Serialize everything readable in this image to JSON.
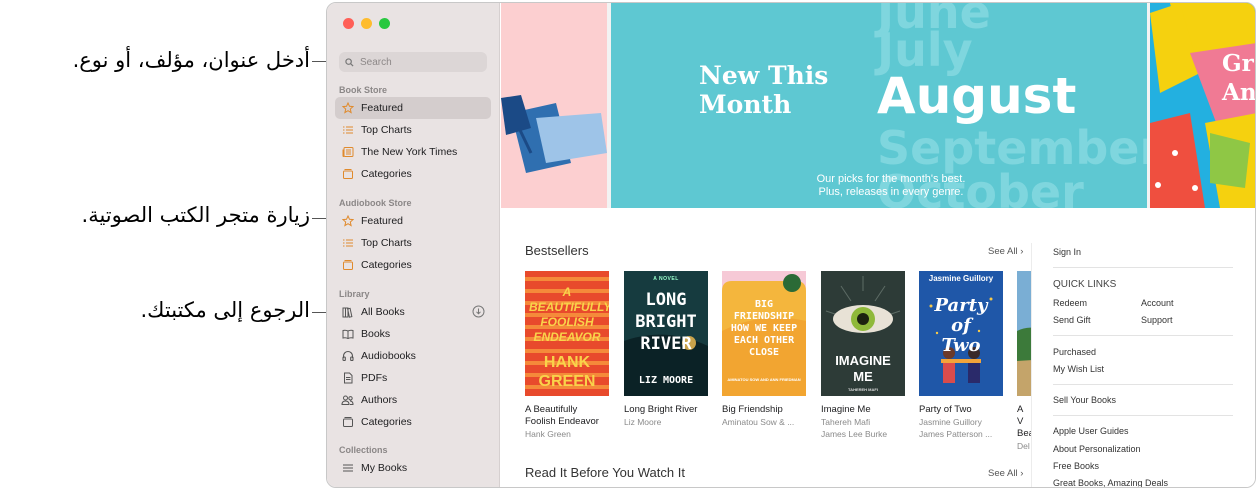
{
  "callouts": {
    "search": "أدخل عنوان، مؤلف، أو نوع.",
    "audiobook": "زيارة متجر الكتب الصوتية.",
    "library": "الرجوع إلى مكتبتك."
  },
  "sidebar": {
    "search_placeholder": "Search",
    "book_store": {
      "title": "Book Store",
      "items": [
        {
          "label": "Featured",
          "icon": "star-icon"
        },
        {
          "label": "Top Charts",
          "icon": "list-icon"
        },
        {
          "label": "The New York Times",
          "icon": "newspaper-icon"
        },
        {
          "label": "Categories",
          "icon": "categories-icon"
        }
      ]
    },
    "audiobook_store": {
      "title": "Audiobook Store",
      "items": [
        {
          "label": "Featured",
          "icon": "star-icon"
        },
        {
          "label": "Top Charts",
          "icon": "list-icon"
        },
        {
          "label": "Categories",
          "icon": "categories-icon"
        }
      ]
    },
    "library": {
      "title": "Library",
      "items": [
        {
          "label": "All Books",
          "icon": "books-icon"
        },
        {
          "label": "Books",
          "icon": "book-icon"
        },
        {
          "label": "Audiobooks",
          "icon": "headphones-icon"
        },
        {
          "label": "PDFs",
          "icon": "document-icon"
        },
        {
          "label": "Authors",
          "icon": "people-icon"
        },
        {
          "label": "Categories",
          "icon": "categories-icon"
        }
      ]
    },
    "collections": {
      "title": "Collections",
      "items": [
        {
          "label": "My Books",
          "icon": "list-icon"
        }
      ]
    }
  },
  "banner": {
    "new_this_month": "New This Month",
    "months": [
      "June",
      "July",
      "August",
      "September",
      "October"
    ],
    "picks_line1": "Our picks for the month's best.",
    "picks_line2": "Plus, releases in every genre.",
    "right_partial_line1": "Gr",
    "right_partial_line2": "An"
  },
  "bestsellers": {
    "title": "Bestsellers",
    "see_all": "See All",
    "books": [
      {
        "title": "A Beautifully Foolish Endeavor",
        "author": "Hank Green",
        "cover_text": "A BEAUTIFULLY FOOLISH ENDEAVOR",
        "cover_author": "HANK GREEN"
      },
      {
        "title": "Long Bright River",
        "author": "Liz Moore",
        "cover_text": "LONG BRIGHT RIVER",
        "cover_author": "LIZ MOORE",
        "cover_kicker": "A NOVEL"
      },
      {
        "title": "Big Friendship",
        "author": "Aminatou Sow & ...",
        "cover_text": "BIG FRIENDSHIP HOW WE KEEP EACH OTHER CLOSE",
        "cover_author": "AMINATOU SOW AND ANN FRIEDMAN"
      },
      {
        "title": "Imagine Me",
        "author": "Tahereh Mafi",
        "author2": "James Lee Burke",
        "cover_text": "IMAGINE ME",
        "cover_author": "TAHEREH MAFI"
      },
      {
        "title": "Party of Two",
        "author": "Jasmine Guillory",
        "author2": "James Patterson ...",
        "cover_text": "Party of Two",
        "cover_author": "Jasmine Guillory"
      },
      {
        "title": "A V",
        "title2": "Bea",
        "author": "Del"
      }
    ]
  },
  "next_section": {
    "title": "Read It Before You Watch It",
    "see_all": "See All"
  },
  "quick_links": {
    "sign_in": "Sign In",
    "heading": "QUICK LINKS",
    "redeem": "Redeem",
    "account": "Account",
    "send_gift": "Send Gift",
    "support": "Support",
    "purchased": "Purchased",
    "wish_list": "My Wish List",
    "sell": "Sell Your Books",
    "guides": "Apple User Guides",
    "personalization": "About Personalization",
    "free": "Free Books",
    "deals": "Great Books, Amazing Deals"
  },
  "colors": {
    "accent": "#e08a2c",
    "banner_teal": "#5ec8d2",
    "sidebar": "#e9e3e3"
  }
}
